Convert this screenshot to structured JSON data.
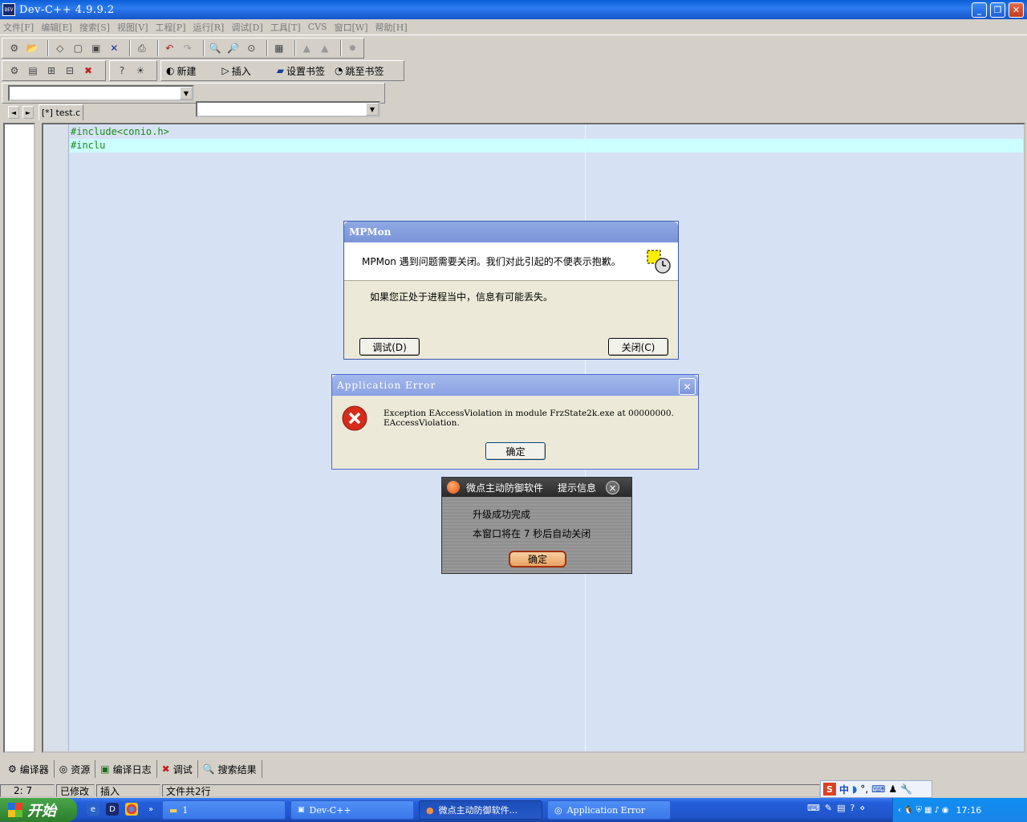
{
  "window": {
    "title": "Dev-C++ 4.9.9.2",
    "icon_text": "DEV",
    "buttons": {
      "minimize": "_",
      "restore": "❐",
      "close": "✕"
    }
  },
  "menu": [
    "文件[F]",
    "编辑[E]",
    "搜索[S]",
    "视图[V]",
    "工程[P]",
    "运行[R]",
    "调试[D]",
    "工具[T]",
    "CVS",
    "窗口[W]",
    "帮助[H]"
  ],
  "toolbar2": {
    "new_label": "新建",
    "insert_label": "插入",
    "set_bookmark_label": "设置书签",
    "goto_bookmark_label": "跳至书签"
  },
  "editor": {
    "tab_label": "[*] test.c",
    "nav_left": "◄",
    "nav_right": "►",
    "lines": [
      "#include<conio.h>",
      "#inclu"
    ]
  },
  "dialog_mpmon": {
    "title": "MPMon",
    "message": "MPMon 遇到问题需要关闭。我们对此引起的不便表示抱歉。",
    "sub_message": "如果您正处于进程当中，信息有可能丢失。",
    "debug_button": "调试(D)",
    "close_button": "关闭(C)"
  },
  "dialog_app_error": {
    "title": "Application Error",
    "line1": "Exception EAccessViolation in module FrzState2k.exe at 00000000.",
    "line2": "EAccessViolation.",
    "ok_button": "确定",
    "close_glyph": "✕"
  },
  "dialog_weidian": {
    "title_left": "微点主动防御软件",
    "title_right": "提示信息",
    "line1": "升级成功完成",
    "line2": "本窗口将在 7 秒后自动关闭",
    "ok_button": "确定",
    "close_glyph": "×"
  },
  "bottom_tabs": [
    "编译器",
    "资源",
    "编译日志",
    "调试",
    "搜索结果"
  ],
  "statusbar": {
    "position": "2: 7",
    "modified": "已修改",
    "mode": "插入",
    "line_count": "文件共2行"
  },
  "ime": {
    "cn": "中"
  },
  "taskbar": {
    "start_label": "开始",
    "items": [
      {
        "label": "1"
      },
      {
        "label": "Dev-C++"
      },
      {
        "label": "微点主动防御软件..."
      },
      {
        "label": "Application Error"
      }
    ],
    "clock": "17:16"
  },
  "colors": {
    "editor_bg": "#d6e2f4",
    "code_green": "#1a8a1a",
    "current_line": "#ccffff",
    "xp_blue": "#0a5fd8",
    "start_green": "#3a923a"
  }
}
